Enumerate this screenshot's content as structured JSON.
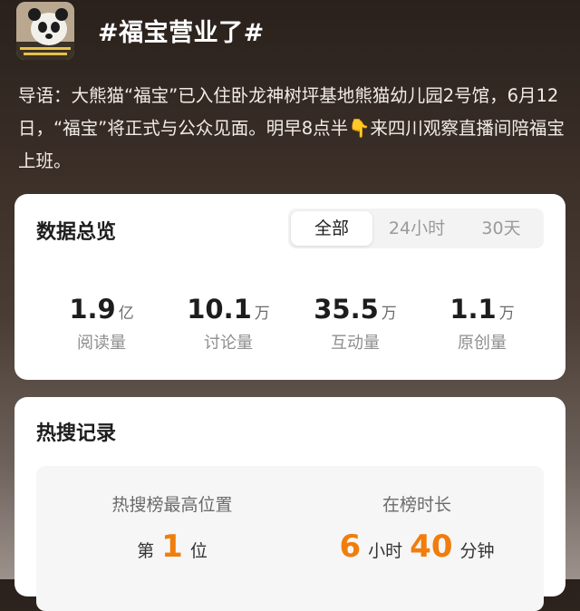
{
  "header": {
    "topic": "#福宝营业了#",
    "intro_before": "导语：大熊猫“福宝”已入住卧龙神树坪基地熊猫幼儿园2号馆，6月12日，“福宝”将正式与公众见面。明早8点半",
    "intro_after": "来四川观察直播间陪福宝上班。"
  },
  "overview": {
    "title": "数据总览",
    "tabs": [
      "全部",
      "24小时",
      "30天"
    ],
    "stats": [
      {
        "value": "1.9",
        "unit": "亿",
        "label": "阅读量"
      },
      {
        "value": "10.1",
        "unit": "万",
        "label": "讨论量"
      },
      {
        "value": "35.5",
        "unit": "万",
        "label": "互动量"
      },
      {
        "value": "1.1",
        "unit": "万",
        "label": "原创量"
      }
    ]
  },
  "hot_search": {
    "title": "热搜记录",
    "highest": {
      "label": "热搜榜最高位置",
      "prefix": "第",
      "value": "1",
      "suffix": "位"
    },
    "duration": {
      "label": "在榜时长",
      "hours": "6",
      "hours_unit": "小时",
      "minutes": "40",
      "minutes_unit": "分钟"
    }
  }
}
